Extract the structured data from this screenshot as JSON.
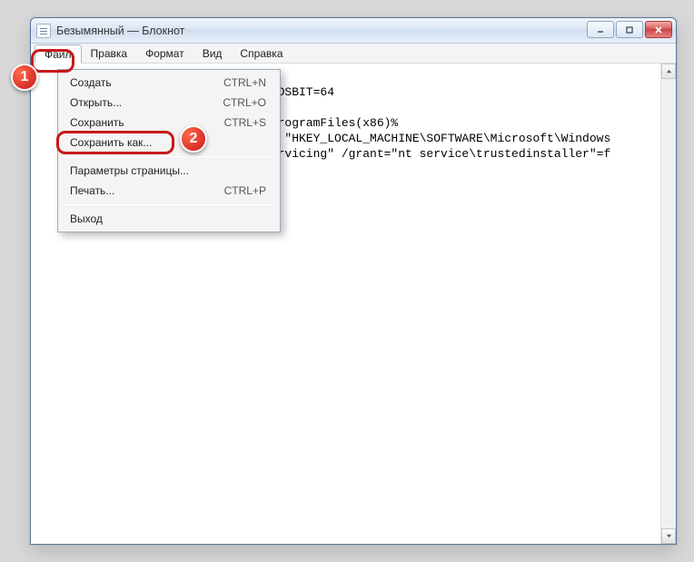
{
  "title": "Безымянный — Блокнот",
  "menubar": {
    "file": "Файл",
    "edit": "Правка",
    "format": "Формат",
    "view": "Вид",
    "help": "Справка"
  },
  "file_menu": {
    "new": {
      "label": "Создать",
      "accel": "CTRL+N"
    },
    "open": {
      "label": "Открыть...",
      "accel": "CTRL+O"
    },
    "save": {
      "label": "Сохранить",
      "accel": "CTRL+S"
    },
    "saveas": {
      "label": "Сохранить как...",
      "accel": ""
    },
    "pagesetup": {
      "label": "Параметры страницы...",
      "accel": ""
    },
    "print": {
      "label": "Печать...",
      "accel": "CTRL+P"
    },
    "exit": {
      "label": "Выход",
      "accel": ""
    }
  },
  "editor_fragments": {
    "l1": "t OSBIT=64",
    "l3": "%ProgramFiles(x86)%",
    "l4": "eg \"HKEY_LOCAL_MACHINE\\SOFTWARE\\Microsoft\\Windows",
    "l5": "Servicing\" /grant=\"nt service\\trustedinstaller\"=f"
  },
  "annotations": {
    "badge1": "1",
    "badge2": "2"
  }
}
